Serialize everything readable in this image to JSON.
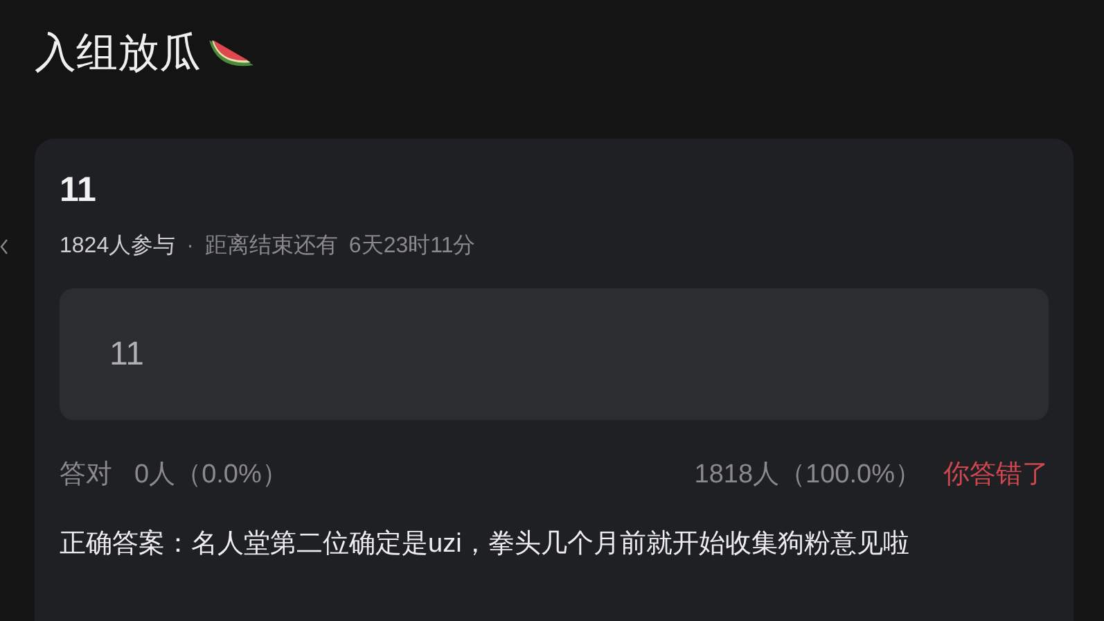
{
  "title": "入组放瓜",
  "quiz": {
    "question": "11",
    "participants": "1824人参与",
    "separator": "·",
    "countdown_label": "距离结束还有",
    "countdown": "6天23时11分",
    "answer": "11",
    "correct_label": "答对",
    "correct_count": "0人（0.0%）",
    "wrong_count": "1818人（100.0%）",
    "result": "你答错了",
    "correct_answer": "正确答案：名人堂第二位确定是uzi，拳头几个月前就开始收集狗粉意见啦"
  }
}
